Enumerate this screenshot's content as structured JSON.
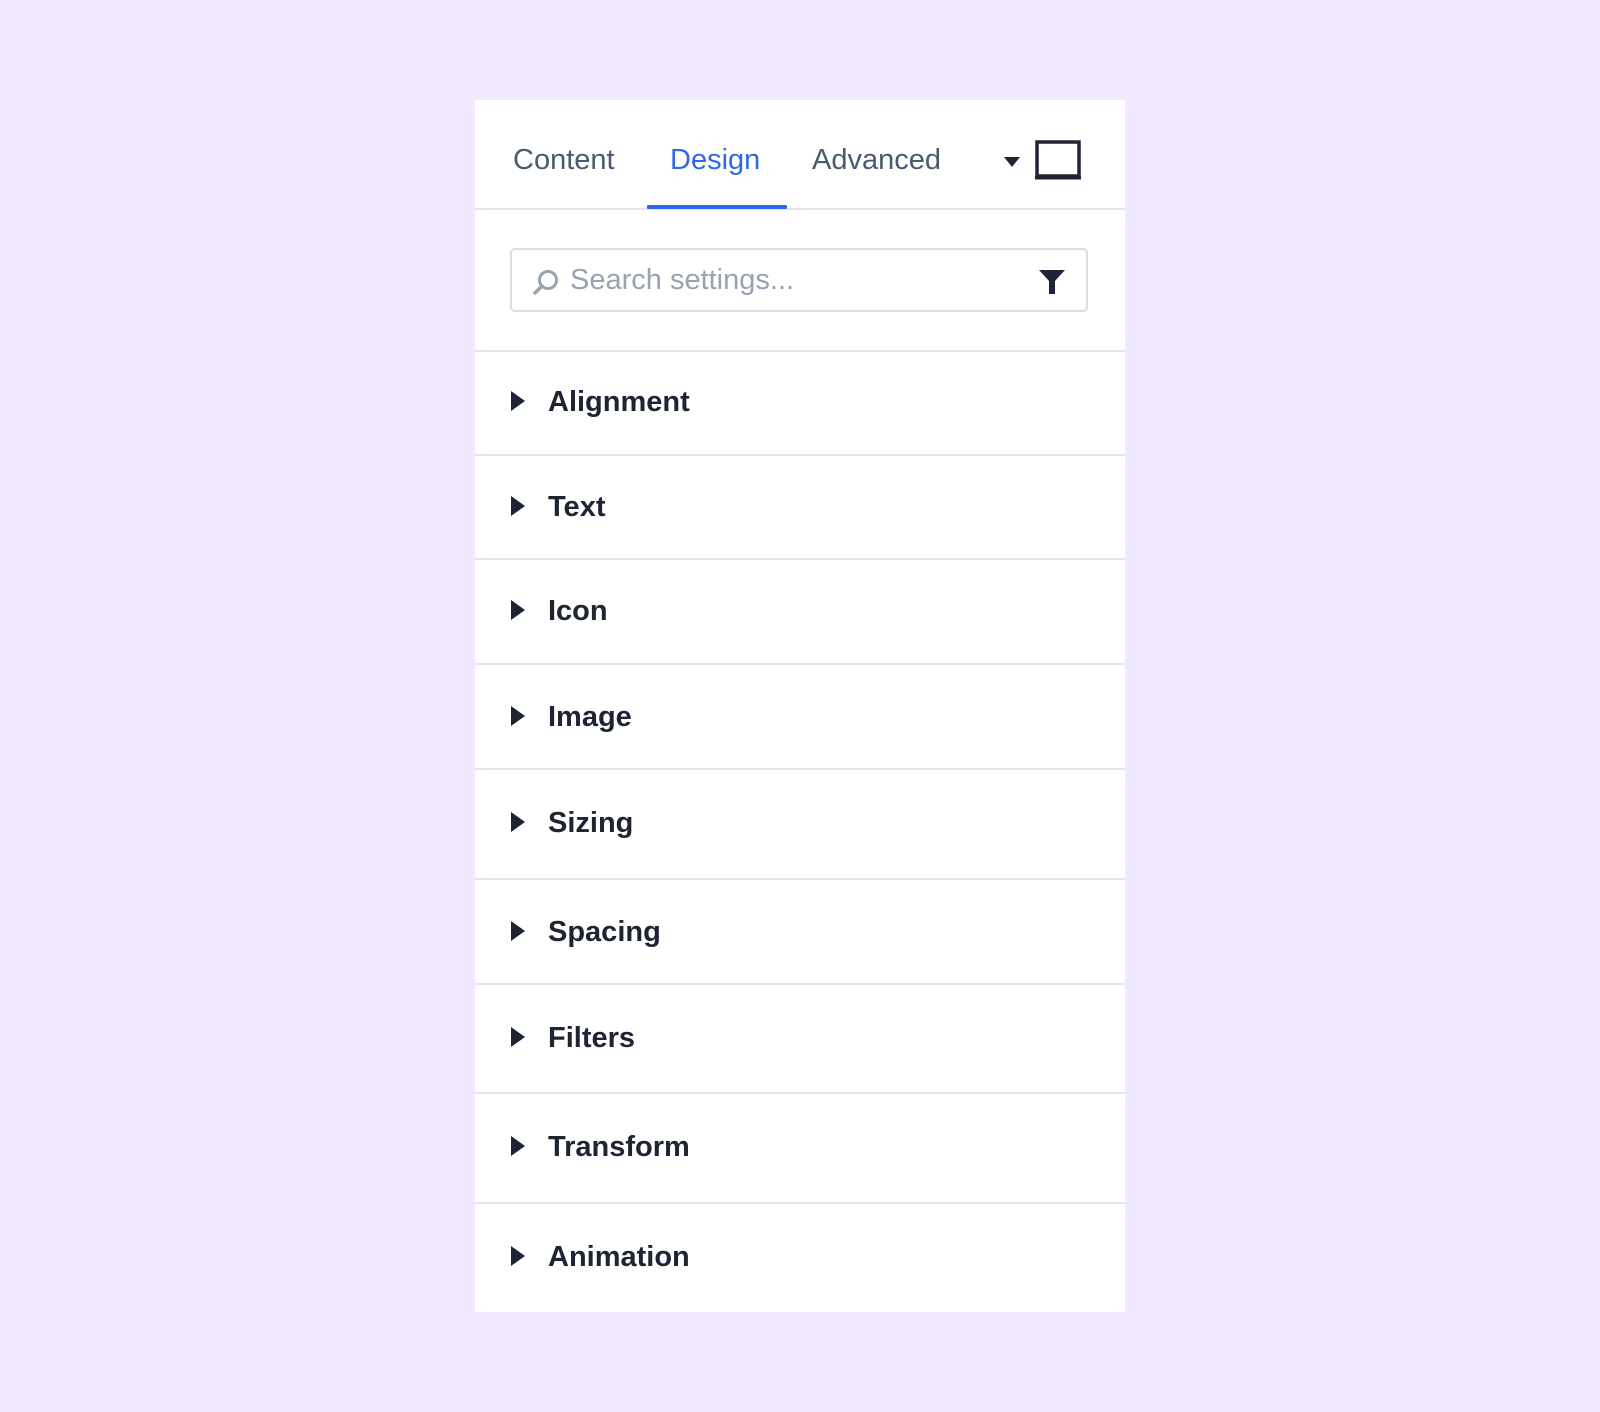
{
  "tabs": [
    {
      "label": "Content",
      "active": false
    },
    {
      "label": "Design",
      "active": true
    },
    {
      "label": "Advanced",
      "active": false
    }
  ],
  "icons": {
    "dropdown": "caret-down-icon",
    "view": "desktop-view-icon",
    "search": "search-icon",
    "filter": "filter-icon",
    "expand": "caret-right-icon"
  },
  "search": {
    "placeholder": "Search settings...",
    "value": ""
  },
  "sections": [
    {
      "label": "Alignment"
    },
    {
      "label": "Text"
    },
    {
      "label": "Icon"
    },
    {
      "label": "Image"
    },
    {
      "label": "Sizing"
    },
    {
      "label": "Spacing"
    },
    {
      "label": "Filters"
    },
    {
      "label": "Transform"
    },
    {
      "label": "Animation"
    }
  ],
  "colors": {
    "background": "#f1e9ff",
    "panel": "#ffffff",
    "accent": "#2f67e8",
    "tab_text": "#4a5a70",
    "section_text": "#1e2433",
    "divider": "#e3e4ea",
    "placeholder": "#98a2b3"
  }
}
